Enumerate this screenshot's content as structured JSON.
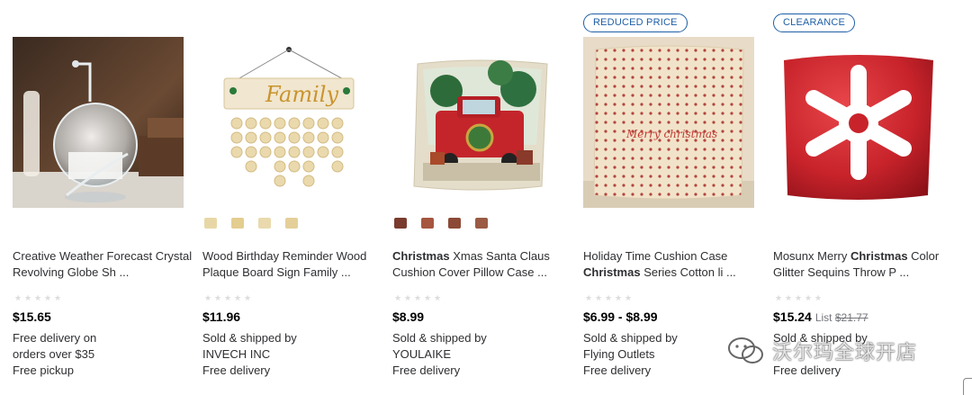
{
  "products": [
    {
      "flag": "",
      "title_parts": [
        {
          "t": "Creative Weather Forecast Crystal Revolving Globe Sh ...",
          "b": false
        }
      ],
      "price": "$15.65",
      "list_label": "",
      "list_price": "",
      "fulfillment": [
        "Free delivery on",
        "orders over $35",
        "Free pickup"
      ],
      "swatches": []
    },
    {
      "flag": "",
      "title_parts": [
        {
          "t": "Wood Birthday Reminder Wood Plaque Board Sign Family ...",
          "b": false
        }
      ],
      "price": "$11.96",
      "list_label": "",
      "list_price": "",
      "fulfillment": [
        "Sold & shipped by",
        "INVECH INC",
        "Free delivery"
      ],
      "swatches": [
        "#e8d7a6",
        "#e3cd8f",
        "#ead9ad",
        "#e4cf98"
      ]
    },
    {
      "flag": "",
      "title_parts": [
        {
          "t": "Christmas",
          "b": true
        },
        {
          "t": " Xmas Santa Claus Cushion Cover Pillow Case ...",
          "b": false
        }
      ],
      "price": "$8.99",
      "list_label": "",
      "list_price": "",
      "fulfillment": [
        "Sold & shipped by",
        "YOULAIKE",
        "Free delivery"
      ],
      "swatches": [
        "#7a3b2e",
        "#a6553f",
        "#8c4a36",
        "#9b5a44"
      ]
    },
    {
      "flag": "REDUCED PRICE",
      "title_parts": [
        {
          "t": "Holiday Time Cushion Case ",
          "b": false
        },
        {
          "t": "Christmas",
          "b": true
        },
        {
          "t": " Series Cotton li ...",
          "b": false
        }
      ],
      "price": "$6.99 - $8.99",
      "list_label": "",
      "list_price": "",
      "fulfillment": [
        "Sold & shipped by",
        "Flying Outlets",
        "Free delivery"
      ],
      "swatches": []
    },
    {
      "flag": "CLEARANCE",
      "title_parts": [
        {
          "t": "Mosunx Merry ",
          "b": false
        },
        {
          "t": "Christmas",
          "b": true
        },
        {
          "t": " Color Glitter Sequins Throw P ...",
          "b": false
        }
      ],
      "price": "$15.24",
      "list_label": "List",
      "list_price": "$21.77",
      "fulfillment": [
        "Sold & shipped by",
        "",
        "Free delivery"
      ],
      "swatches": []
    }
  ],
  "images": {
    "family_sign_text": "Family",
    "pillow_text": "Merry christmas"
  },
  "watermark": {
    "text": "沃尔玛全球开店",
    "icon": "wechat-icon"
  },
  "colors": {
    "flag": "#1f5fa6",
    "star_empty": "#dcdcdc",
    "strike": "#74767c"
  }
}
